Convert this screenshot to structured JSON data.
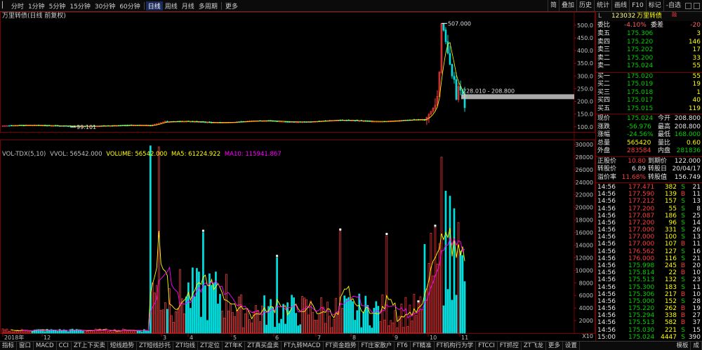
{
  "periods": [
    "分时",
    "1分钟",
    "5分钟",
    "15分钟",
    "30分钟",
    "60分钟",
    "日线",
    "周线",
    "月线",
    "多周期",
    "更多"
  ],
  "selected_period": "日线",
  "toolbar": [
    "简",
    "叠加",
    "历史",
    "统计",
    "画线",
    "F10",
    "标记",
    "-自选"
  ],
  "price_title": "万里转债(日线 前复权)",
  "high_label": "507.000",
  "low_label": "99.101",
  "range_label": "228.010 - 208.800",
  "price_axis": [
    "500.0",
    "450.0",
    "400.0",
    "350.0",
    "300.0",
    "250.0",
    "200.0",
    "150.0",
    "100.0"
  ],
  "indicator": {
    "name": "VOL-TDX(5,10)",
    "vvol": "VVOL: 56542.000",
    "volume": "VOLUME: 56542.000",
    "ma5": "MA5: 61224.922",
    "ma10": "MA10: 115941.867",
    "color_volume": "#ffff00",
    "color_ma5": "#ffff00",
    "color_ma10": "#ff00ff"
  },
  "vol_axis": [
    "30000",
    "28000",
    "26000",
    "24000",
    "22000",
    "20000",
    "18000",
    "16000",
    "14000",
    "12000",
    "10000",
    "8000",
    "6000",
    "4000",
    "2000"
  ],
  "vol_unit": "X10",
  "xaxis": [
    "2018年",
    "12",
    "3",
    "4",
    "5",
    "6",
    "7",
    "8",
    "9",
    "10",
    "11"
  ],
  "chart_data": {
    "type": "candlestick",
    "title": "万里转债(日线 前复权)",
    "price_max": 507.0,
    "price_min": 99.101,
    "price_range_shown": [
      228.01,
      208.8
    ],
    "volume_peaks": [
      29800,
      29600,
      28000,
      22600,
      21800,
      19800,
      17600,
      16800,
      16200
    ],
    "vol_ylim": [
      0,
      30000
    ],
    "price_ylim": [
      80,
      530
    ],
    "colors": {
      "up": "#ff3c3c",
      "down": "#00e0e0"
    }
  },
  "quote": {
    "market": "L",
    "code": "123032",
    "name": "万里转债",
    "badge": "融",
    "weibi_label": "委比",
    "weibi": "-4.10%",
    "weicha_label": "委差",
    "weicha": "-20",
    "asks": [
      {
        "label": "卖五",
        "price": "175.306",
        "vol": "3"
      },
      {
        "label": "卖四",
        "price": "175.220",
        "vol": "146"
      },
      {
        "label": "卖三",
        "price": "175.202",
        "vol": "17"
      },
      {
        "label": "卖二",
        "price": "175.200",
        "vol": "33"
      },
      {
        "label": "卖一",
        "price": "175.024",
        "vol": "55"
      }
    ],
    "bids": [
      {
        "label": "买一",
        "price": "175.020",
        "vol": "55"
      },
      {
        "label": "买二",
        "price": "175.019",
        "vol": "19"
      },
      {
        "label": "买三",
        "price": "175.018",
        "vol": "1"
      },
      {
        "label": "买四",
        "price": "175.017",
        "vol": "40"
      },
      {
        "label": "买五",
        "price": "175.015",
        "vol": "119"
      }
    ],
    "stats": [
      {
        "l1": "现价",
        "v1": "175.024",
        "c1": "grn",
        "l2": "今开",
        "v2": "208.800",
        "c2": "wht"
      },
      {
        "l1": "涨跌",
        "v1": "-56.976",
        "c1": "grn",
        "l2": "最高",
        "v2": "208.800",
        "c2": "wht"
      },
      {
        "l1": "涨幅",
        "v1": "-24.56%",
        "c1": "grn",
        "l2": "最低",
        "v2": "168.000",
        "c2": "grn"
      },
      {
        "l1": "总量",
        "v1": "565420",
        "c1": "yel",
        "l2": "量比",
        "v2": "0.60",
        "c2": "yel"
      },
      {
        "l1": "外盘",
        "v1": "283584",
        "c1": "red",
        "l2": "内盘",
        "v2": "281836",
        "c2": "grn"
      }
    ],
    "bond": [
      {
        "l1": "正股价",
        "v1": "10.80",
        "c1": "red",
        "l2": "到期价",
        "v2": "122.000",
        "c2": "wht"
      },
      {
        "l1": "转股价",
        "v1": "6.89",
        "c1": "wht",
        "l2": "转股日",
        "v2": "20/04/17",
        "c2": "wht"
      },
      {
        "l1": "溢价率",
        "v1": "11.68%",
        "c1": "red",
        "l2": "转股值",
        "v2": "156.749",
        "c2": "wht"
      }
    ],
    "ticks": [
      {
        "t": "14:56",
        "p": "177.471",
        "pc": "red",
        "v": "382",
        "d": "S",
        "n": "21"
      },
      {
        "t": "14:56",
        "p": "177.590",
        "pc": "red",
        "v": "139",
        "d": "B",
        "n": "11"
      },
      {
        "t": "14:56",
        "p": "177.212",
        "pc": "red",
        "v": "157",
        "d": "S",
        "n": "13"
      },
      {
        "t": "14:56",
        "p": "177.200",
        "pc": "red",
        "v": "55",
        "d": "S",
        "n": "8"
      },
      {
        "t": "14:56",
        "p": "177.087",
        "pc": "red",
        "v": "186",
        "d": "S",
        "n": "25"
      },
      {
        "t": "14:56",
        "p": "177.200",
        "pc": "red",
        "v": "96",
        "d": "S",
        "n": "14"
      },
      {
        "t": "14:56",
        "p": "177.000",
        "pc": "red",
        "v": "331",
        "d": "S",
        "n": "26"
      },
      {
        "t": "14:56",
        "p": "177.000",
        "pc": "red",
        "v": "100",
        "d": "S",
        "n": "13"
      },
      {
        "t": "14:56",
        "p": "177.000",
        "pc": "red",
        "v": "107",
        "d": "B",
        "n": "11"
      },
      {
        "t": "14:56",
        "p": "176.562",
        "pc": "red",
        "v": "127",
        "d": "S",
        "n": "16"
      },
      {
        "t": "14:56",
        "p": "176.000",
        "pc": "red",
        "v": "116",
        "d": "S",
        "n": "21"
      },
      {
        "t": "14:56",
        "p": "175.998",
        "pc": "grn",
        "v": "245",
        "d": "B",
        "n": "20"
      },
      {
        "t": "14:56",
        "p": "175.814",
        "pc": "grn",
        "v": "22",
        "d": "B",
        "n": "10"
      },
      {
        "t": "14:56",
        "p": "175.513",
        "pc": "grn",
        "v": "132",
        "d": "S",
        "n": "23"
      },
      {
        "t": "14:56",
        "p": "175.300",
        "pc": "grn",
        "v": "183",
        "d": "S",
        "n": "11"
      },
      {
        "t": "14:56",
        "p": "175.306",
        "pc": "grn",
        "v": "217",
        "d": "B",
        "n": "10"
      },
      {
        "t": "14:56",
        "p": "175.000",
        "pc": "grn",
        "v": "152",
        "d": "S",
        "n": "28"
      },
      {
        "t": "14:56",
        "p": "175.220",
        "pc": "grn",
        "v": "262",
        "d": "B",
        "n": "19"
      },
      {
        "t": "14:56",
        "p": "175.294",
        "pc": "grn",
        "v": "338",
        "d": "B",
        "n": "27"
      },
      {
        "t": "14:56",
        "p": "175.513",
        "pc": "grn",
        "v": "582",
        "d": "B",
        "n": "37"
      },
      {
        "t": "14:56",
        "p": "175.030",
        "pc": "grn",
        "v": "221",
        "d": "S",
        "n": "15"
      },
      {
        "t": "15:00",
        "p": "175.024",
        "pc": "grn",
        "v": "4447",
        "d": "S",
        "n": "390"
      }
    ]
  },
  "bottom_tabs": [
    "指标",
    "窗口",
    "MACD",
    "CCI",
    "ZT上下买卖",
    "短线趋势",
    "ZT短线抄托",
    "ZT均线",
    "ZT定位",
    "ZT年K",
    "ZT真买盘卖",
    "FT九转MACD",
    "FT资金趋势",
    "FT庄家散户",
    "FT6",
    "FT精准",
    "FT机构行为学",
    "FTCCI",
    "FT抓控",
    "ZT飞龙",
    "更多",
    "设置"
  ],
  "bottom_right": [
    "模板",
    "成"
  ]
}
